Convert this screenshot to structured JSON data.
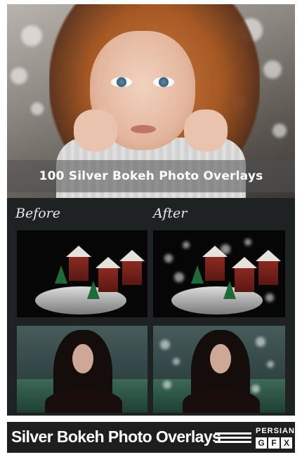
{
  "hero": {
    "title": "100 Silver Bokeh Photo Overlays"
  },
  "comparison": {
    "before_label": "Before",
    "after_label": "After"
  },
  "footer": {
    "title": "Silver Bokeh Photo Overlays",
    "brand_top": "PERSIAN",
    "brand_boxes": [
      "G",
      "F",
      "X"
    ]
  }
}
